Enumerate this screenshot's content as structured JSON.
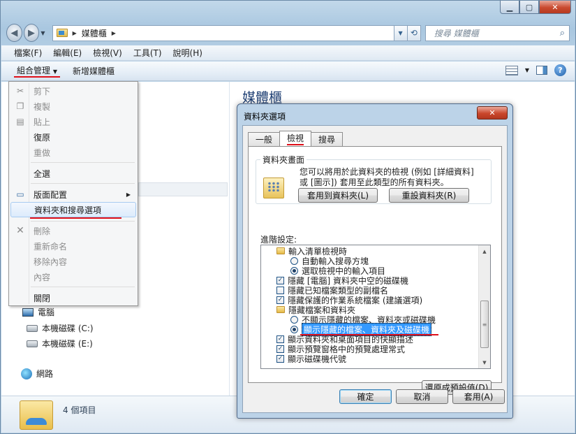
{
  "window": {
    "minimize_icon": "minimize-icon",
    "maximize_icon": "maximize-icon",
    "close_icon": "close-icon"
  },
  "address": {
    "crumbs": [
      "媒體櫃"
    ],
    "search_placeholder": "搜尋 媒體櫃"
  },
  "menubar": [
    "檔案(F)",
    "編輯(E)",
    "檢視(V)",
    "工具(T)",
    "說明(H)"
  ],
  "toolbar": {
    "organize": "組合管理",
    "new_library": "新增媒體櫃"
  },
  "library_title": "媒體櫃",
  "navpane": {
    "computer": "電腦",
    "drive_c": "本機磁碟 (C:)",
    "drive_e": "本機磁碟 (E:)",
    "network": "網路"
  },
  "status": {
    "count": "4 個項目"
  },
  "organize_menu": [
    {
      "label": "剪下",
      "disabled": true,
      "icon": "scissors-icon"
    },
    {
      "label": "複製",
      "disabled": true,
      "icon": "copy-icon"
    },
    {
      "label": "貼上",
      "disabled": true,
      "icon": "paste-icon"
    },
    {
      "label": "復原",
      "disabled": false
    },
    {
      "label": "重做",
      "disabled": true
    },
    {
      "label": "全選",
      "disabled": false
    },
    {
      "label": "版面配置",
      "disabled": false,
      "icon": "layout-icon",
      "submenu": true
    },
    {
      "label": "資料夾和搜尋選項",
      "disabled": false,
      "highlighted": true
    },
    {
      "label": "刪除",
      "disabled": true,
      "icon": "delete-icon"
    },
    {
      "label": "重新命名",
      "disabled": true
    },
    {
      "label": "移除內容",
      "disabled": true
    },
    {
      "label": "內容",
      "disabled": true
    },
    {
      "label": "關閉",
      "disabled": false
    }
  ],
  "dialog": {
    "title": "資料夾選項",
    "tabs": [
      "一般",
      "檢視",
      "搜尋"
    ],
    "active_tab": "檢視",
    "group_title": "資料夾畫面",
    "group_text": "您可以將用於此資料夾的檢視 (例如 [詳細資料] 或 [圖示]) 套用至此類型的所有資料夾。",
    "apply_button": "套用到資料夾(L)",
    "reset_button": "重設資料夾(R)",
    "advanced_label": "進階設定:",
    "tree": [
      {
        "type": "folder",
        "label": "輸入清單檢視時",
        "indent": 0
      },
      {
        "type": "radio",
        "label": "自動輸入搜尋方塊",
        "checked": false,
        "indent": 1
      },
      {
        "type": "radio",
        "label": "選取檢視中的輸入項目",
        "checked": true,
        "indent": 1
      },
      {
        "type": "check",
        "label": "隱藏 [電腦] 資料夾中空的磁碟機",
        "checked": true,
        "indent": 0
      },
      {
        "type": "check",
        "label": "隱藏已知檔案類型的副檔名",
        "checked": false,
        "indent": 0
      },
      {
        "type": "check",
        "label": "隱藏保護的作業系統檔案 (建議選項)",
        "checked": true,
        "indent": 0
      },
      {
        "type": "folder",
        "label": "隱藏檔案和資料夾",
        "indent": 0
      },
      {
        "type": "radio",
        "label": "不顯示隱藏的檔案、資料夾或磁碟機",
        "checked": false,
        "indent": 1
      },
      {
        "type": "radio",
        "label": "顯示隱藏的檔案、資料夾及磁碟機",
        "checked": true,
        "indent": 1,
        "selected": true
      },
      {
        "type": "check",
        "label": "顯示資料夾和桌面項目的快顯描述",
        "checked": true,
        "indent": 0
      },
      {
        "type": "check",
        "label": "顯示預覽窗格中的預覽處理常式",
        "checked": true,
        "indent": 0
      },
      {
        "type": "check",
        "label": "顯示磁碟機代號",
        "checked": true,
        "indent": 0
      }
    ],
    "restore_button": "還原成預設值(D)",
    "ok_button": "確定",
    "cancel_button": "取消",
    "apply": "套用(A)"
  }
}
